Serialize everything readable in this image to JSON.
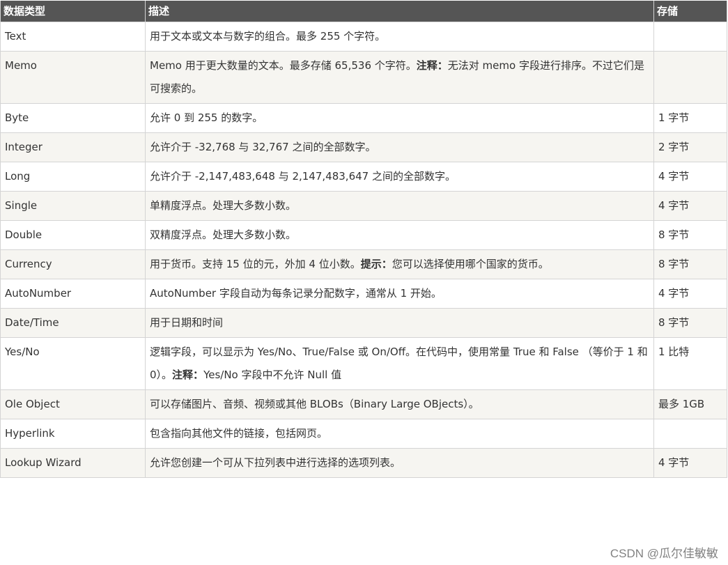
{
  "table": {
    "headers": [
      "数据类型",
      "描述",
      "存储"
    ],
    "rows": [
      {
        "type": "Text",
        "desc": [
          {
            "t": "用于文本或文本与数字的组合。最多 255 个字符。"
          }
        ],
        "storage": ""
      },
      {
        "type": "Memo",
        "desc": [
          {
            "t": "Memo 用于更大数量的文本。最多存储 65,536 个字符。"
          },
          {
            "t": "注释：",
            "b": true
          },
          {
            "t": "无法对 memo 字段进行排序。不过它们是可搜索的。"
          }
        ],
        "storage": ""
      },
      {
        "type": "Byte",
        "desc": [
          {
            "t": "允许 0 到 255 的数字。"
          }
        ],
        "storage": "1 字节"
      },
      {
        "type": "Integer",
        "desc": [
          {
            "t": "允许介于 -32,768 与 32,767 之间的全部数字。"
          }
        ],
        "storage": "2 字节"
      },
      {
        "type": "Long",
        "desc": [
          {
            "t": "允许介于 -2,147,483,648 与 2,147,483,647 之间的全部数字。"
          }
        ],
        "storage": "4 字节"
      },
      {
        "type": "Single",
        "desc": [
          {
            "t": "单精度浮点。处理大多数小数。"
          }
        ],
        "storage": "4 字节"
      },
      {
        "type": "Double",
        "desc": [
          {
            "t": "双精度浮点。处理大多数小数。"
          }
        ],
        "storage": "8 字节"
      },
      {
        "type": "Currency",
        "desc": [
          {
            "t": "用于货币。支持 15 位的元，外加 4 位小数。"
          },
          {
            "t": "提示：",
            "b": true
          },
          {
            "t": "您可以选择使用哪个国家的货币。"
          }
        ],
        "storage": "8 字节"
      },
      {
        "type": "AutoNumber",
        "desc": [
          {
            "t": "AutoNumber 字段自动为每条记录分配数字，通常从 1 开始。"
          }
        ],
        "storage": "4 字节"
      },
      {
        "type": "Date/Time",
        "desc": [
          {
            "t": "用于日期和时间"
          }
        ],
        "storage": "8 字节"
      },
      {
        "type": "Yes/No",
        "desc": [
          {
            "t": "逻辑字段，可以显示为 Yes/No、True/False 或 On/Off。在代码中，使用常量 True 和 False （等价于 1 和 0）。"
          },
          {
            "t": "注释：",
            "b": true
          },
          {
            "t": "Yes/No 字段中不允许 Null 值"
          }
        ],
        "storage": "1 比特"
      },
      {
        "type": "Ole Object",
        "desc": [
          {
            "t": "可以存储图片、音频、视频或其他 BLOBs（Binary Large OBjects）。"
          }
        ],
        "storage": "最多 1GB"
      },
      {
        "type": "Hyperlink",
        "desc": [
          {
            "t": "包含指向其他文件的链接，包括网页。"
          }
        ],
        "storage": ""
      },
      {
        "type": "Lookup Wizard",
        "desc": [
          {
            "t": "允许您创建一个可从下拉列表中进行选择的选项列表。"
          }
        ],
        "storage": "4 字节"
      }
    ]
  },
  "watermark": "CSDN @瓜尔佳敏敏"
}
